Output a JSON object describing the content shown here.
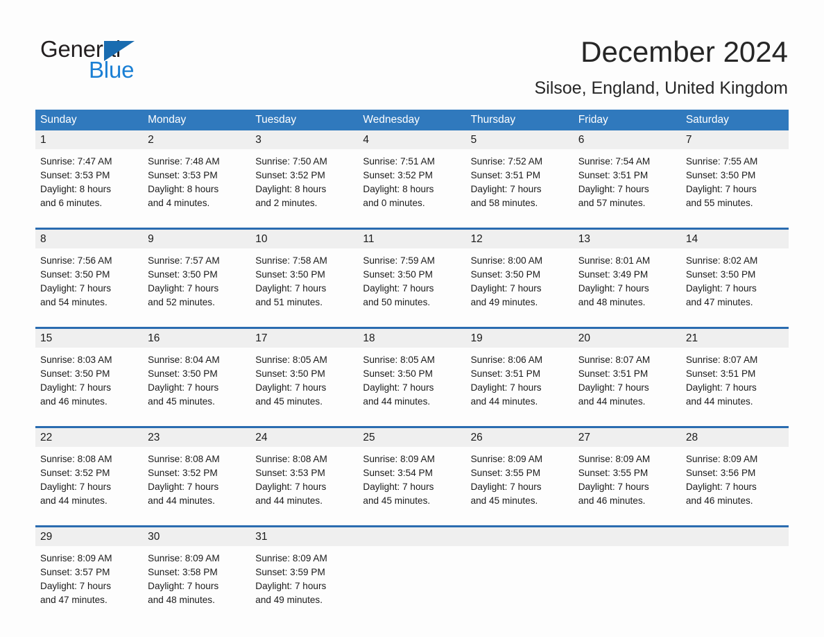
{
  "brand": {
    "logo_text_top": "General",
    "logo_text_bottom": "Blue",
    "logo_icon": "triangle-icon",
    "accent_blue": "#1a7fd4",
    "header_blue": "#3079bd",
    "rule_blue": "#2a6cb0"
  },
  "header": {
    "title": "December 2024",
    "location": "Silsoe, England, United Kingdom"
  },
  "weekdays": [
    "Sunday",
    "Monday",
    "Tuesday",
    "Wednesday",
    "Thursday",
    "Friday",
    "Saturday"
  ],
  "weeks": [
    {
      "days": [
        {
          "date": "1",
          "sunrise": "Sunrise: 7:47 AM",
          "sunset": "Sunset: 3:53 PM",
          "daylight_line1": "Daylight: 8 hours",
          "daylight_line2": "and 6 minutes."
        },
        {
          "date": "2",
          "sunrise": "Sunrise: 7:48 AM",
          "sunset": "Sunset: 3:53 PM",
          "daylight_line1": "Daylight: 8 hours",
          "daylight_line2": "and 4 minutes."
        },
        {
          "date": "3",
          "sunrise": "Sunrise: 7:50 AM",
          "sunset": "Sunset: 3:52 PM",
          "daylight_line1": "Daylight: 8 hours",
          "daylight_line2": "and 2 minutes."
        },
        {
          "date": "4",
          "sunrise": "Sunrise: 7:51 AM",
          "sunset": "Sunset: 3:52 PM",
          "daylight_line1": "Daylight: 8 hours",
          "daylight_line2": "and 0 minutes."
        },
        {
          "date": "5",
          "sunrise": "Sunrise: 7:52 AM",
          "sunset": "Sunset: 3:51 PM",
          "daylight_line1": "Daylight: 7 hours",
          "daylight_line2": "and 58 minutes."
        },
        {
          "date": "6",
          "sunrise": "Sunrise: 7:54 AM",
          "sunset": "Sunset: 3:51 PM",
          "daylight_line1": "Daylight: 7 hours",
          "daylight_line2": "and 57 minutes."
        },
        {
          "date": "7",
          "sunrise": "Sunrise: 7:55 AM",
          "sunset": "Sunset: 3:50 PM",
          "daylight_line1": "Daylight: 7 hours",
          "daylight_line2": "and 55 minutes."
        }
      ]
    },
    {
      "days": [
        {
          "date": "8",
          "sunrise": "Sunrise: 7:56 AM",
          "sunset": "Sunset: 3:50 PM",
          "daylight_line1": "Daylight: 7 hours",
          "daylight_line2": "and 54 minutes."
        },
        {
          "date": "9",
          "sunrise": "Sunrise: 7:57 AM",
          "sunset": "Sunset: 3:50 PM",
          "daylight_line1": "Daylight: 7 hours",
          "daylight_line2": "and 52 minutes."
        },
        {
          "date": "10",
          "sunrise": "Sunrise: 7:58 AM",
          "sunset": "Sunset: 3:50 PM",
          "daylight_line1": "Daylight: 7 hours",
          "daylight_line2": "and 51 minutes."
        },
        {
          "date": "11",
          "sunrise": "Sunrise: 7:59 AM",
          "sunset": "Sunset: 3:50 PM",
          "daylight_line1": "Daylight: 7 hours",
          "daylight_line2": "and 50 minutes."
        },
        {
          "date": "12",
          "sunrise": "Sunrise: 8:00 AM",
          "sunset": "Sunset: 3:50 PM",
          "daylight_line1": "Daylight: 7 hours",
          "daylight_line2": "and 49 minutes."
        },
        {
          "date": "13",
          "sunrise": "Sunrise: 8:01 AM",
          "sunset": "Sunset: 3:49 PM",
          "daylight_line1": "Daylight: 7 hours",
          "daylight_line2": "and 48 minutes."
        },
        {
          "date": "14",
          "sunrise": "Sunrise: 8:02 AM",
          "sunset": "Sunset: 3:50 PM",
          "daylight_line1": "Daylight: 7 hours",
          "daylight_line2": "and 47 minutes."
        }
      ]
    },
    {
      "days": [
        {
          "date": "15",
          "sunrise": "Sunrise: 8:03 AM",
          "sunset": "Sunset: 3:50 PM",
          "daylight_line1": "Daylight: 7 hours",
          "daylight_line2": "and 46 minutes."
        },
        {
          "date": "16",
          "sunrise": "Sunrise: 8:04 AM",
          "sunset": "Sunset: 3:50 PM",
          "daylight_line1": "Daylight: 7 hours",
          "daylight_line2": "and 45 minutes."
        },
        {
          "date": "17",
          "sunrise": "Sunrise: 8:05 AM",
          "sunset": "Sunset: 3:50 PM",
          "daylight_line1": "Daylight: 7 hours",
          "daylight_line2": "and 45 minutes."
        },
        {
          "date": "18",
          "sunrise": "Sunrise: 8:05 AM",
          "sunset": "Sunset: 3:50 PM",
          "daylight_line1": "Daylight: 7 hours",
          "daylight_line2": "and 44 minutes."
        },
        {
          "date": "19",
          "sunrise": "Sunrise: 8:06 AM",
          "sunset": "Sunset: 3:51 PM",
          "daylight_line1": "Daylight: 7 hours",
          "daylight_line2": "and 44 minutes."
        },
        {
          "date": "20",
          "sunrise": "Sunrise: 8:07 AM",
          "sunset": "Sunset: 3:51 PM",
          "daylight_line1": "Daylight: 7 hours",
          "daylight_line2": "and 44 minutes."
        },
        {
          "date": "21",
          "sunrise": "Sunrise: 8:07 AM",
          "sunset": "Sunset: 3:51 PM",
          "daylight_line1": "Daylight: 7 hours",
          "daylight_line2": "and 44 minutes."
        }
      ]
    },
    {
      "days": [
        {
          "date": "22",
          "sunrise": "Sunrise: 8:08 AM",
          "sunset": "Sunset: 3:52 PM",
          "daylight_line1": "Daylight: 7 hours",
          "daylight_line2": "and 44 minutes."
        },
        {
          "date": "23",
          "sunrise": "Sunrise: 8:08 AM",
          "sunset": "Sunset: 3:52 PM",
          "daylight_line1": "Daylight: 7 hours",
          "daylight_line2": "and 44 minutes."
        },
        {
          "date": "24",
          "sunrise": "Sunrise: 8:08 AM",
          "sunset": "Sunset: 3:53 PM",
          "daylight_line1": "Daylight: 7 hours",
          "daylight_line2": "and 44 minutes."
        },
        {
          "date": "25",
          "sunrise": "Sunrise: 8:09 AM",
          "sunset": "Sunset: 3:54 PM",
          "daylight_line1": "Daylight: 7 hours",
          "daylight_line2": "and 45 minutes."
        },
        {
          "date": "26",
          "sunrise": "Sunrise: 8:09 AM",
          "sunset": "Sunset: 3:55 PM",
          "daylight_line1": "Daylight: 7 hours",
          "daylight_line2": "and 45 minutes."
        },
        {
          "date": "27",
          "sunrise": "Sunrise: 8:09 AM",
          "sunset": "Sunset: 3:55 PM",
          "daylight_line1": "Daylight: 7 hours",
          "daylight_line2": "and 46 minutes."
        },
        {
          "date": "28",
          "sunrise": "Sunrise: 8:09 AM",
          "sunset": "Sunset: 3:56 PM",
          "daylight_line1": "Daylight: 7 hours",
          "daylight_line2": "and 46 minutes."
        }
      ]
    },
    {
      "days": [
        {
          "date": "29",
          "sunrise": "Sunrise: 8:09 AM",
          "sunset": "Sunset: 3:57 PM",
          "daylight_line1": "Daylight: 7 hours",
          "daylight_line2": "and 47 minutes."
        },
        {
          "date": "30",
          "sunrise": "Sunrise: 8:09 AM",
          "sunset": "Sunset: 3:58 PM",
          "daylight_line1": "Daylight: 7 hours",
          "daylight_line2": "and 48 minutes."
        },
        {
          "date": "31",
          "sunrise": "Sunrise: 8:09 AM",
          "sunset": "Sunset: 3:59 PM",
          "daylight_line1": "Daylight: 7 hours",
          "daylight_line2": "and 49 minutes."
        },
        {
          "date": "",
          "sunrise": "",
          "sunset": "",
          "daylight_line1": "",
          "daylight_line2": ""
        },
        {
          "date": "",
          "sunrise": "",
          "sunset": "",
          "daylight_line1": "",
          "daylight_line2": ""
        },
        {
          "date": "",
          "sunrise": "",
          "sunset": "",
          "daylight_line1": "",
          "daylight_line2": ""
        },
        {
          "date": "",
          "sunrise": "",
          "sunset": "",
          "daylight_line1": "",
          "daylight_line2": ""
        }
      ]
    }
  ]
}
